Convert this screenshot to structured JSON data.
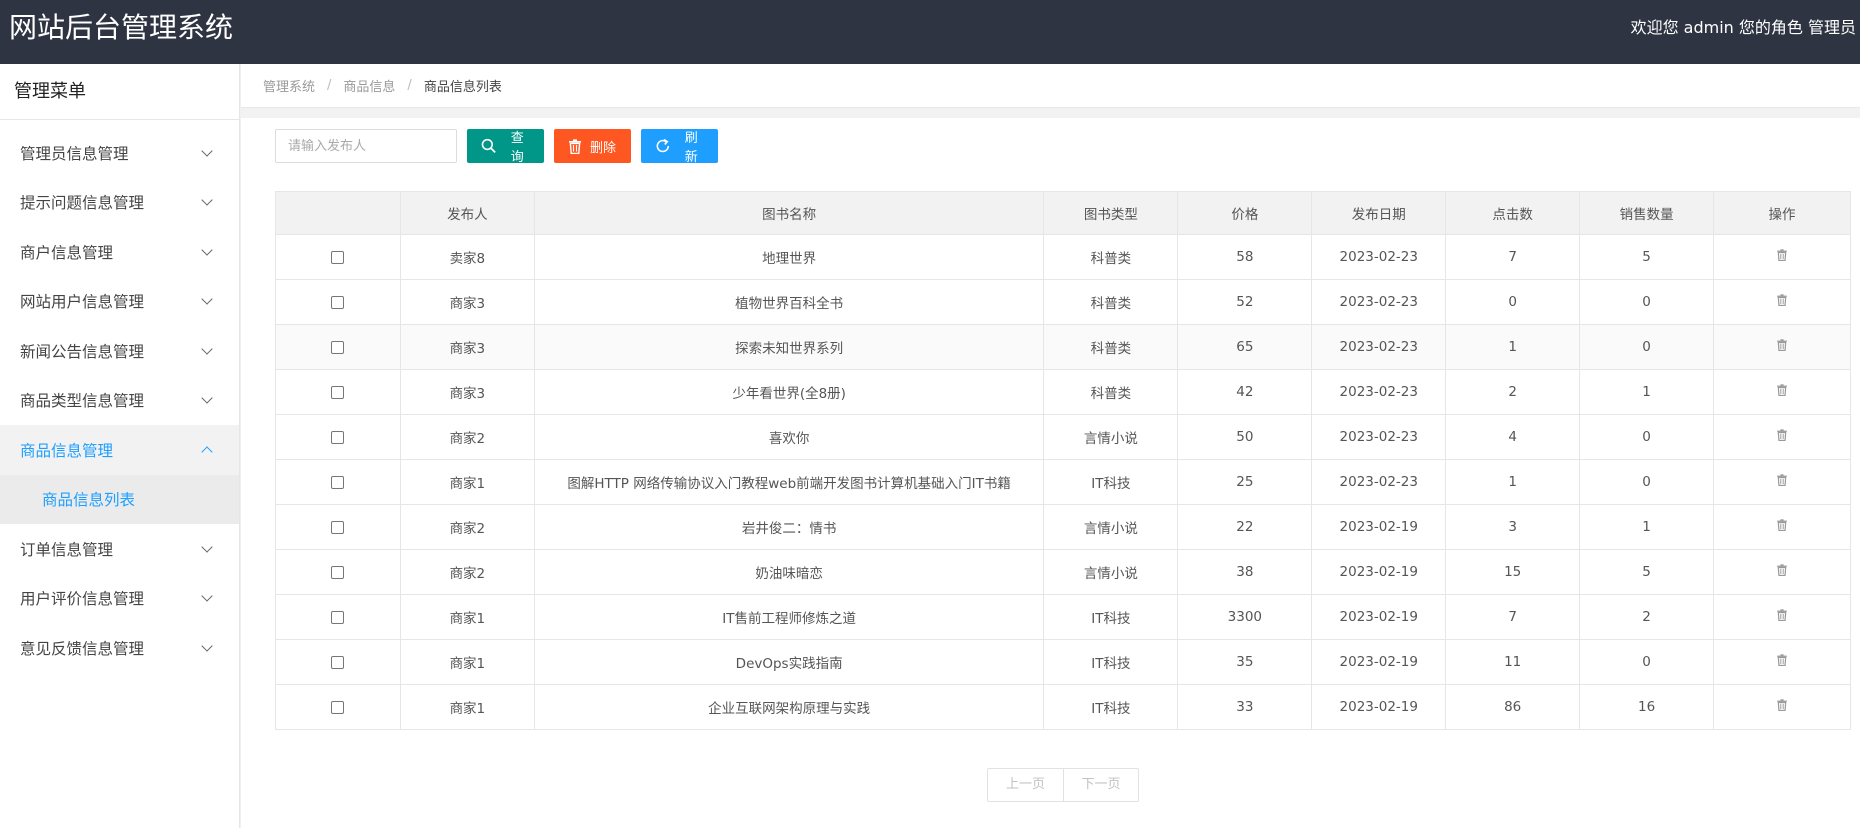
{
  "header": {
    "app_title": "网站后台管理系统",
    "welcome": "欢迎您 admin 您的角色 管理员"
  },
  "sidebar": {
    "title": "管理菜单",
    "items": [
      {
        "label": "管理员信息管理"
      },
      {
        "label": "提示问题信息管理"
      },
      {
        "label": "商户信息管理"
      },
      {
        "label": "网站用户信息管理"
      },
      {
        "label": "新闻公告信息管理"
      },
      {
        "label": "商品类型信息管理"
      },
      {
        "label": "商品信息管理"
      },
      {
        "label": "订单信息管理"
      },
      {
        "label": "用户评价信息管理"
      },
      {
        "label": "意见反馈信息管理"
      }
    ],
    "active_sub_item": "商品信息列表"
  },
  "breadcrumb": [
    "管理系统",
    "商品信息",
    "商品信息列表"
  ],
  "toolbar": {
    "search_placeholder": "请输入发布人",
    "query_label": "查询",
    "delete_label": "删除",
    "refresh_label": "刷新"
  },
  "table": {
    "columns": [
      "发布人",
      "图书名称",
      "图书类型",
      "价格",
      "发布日期",
      "点击数",
      "销售数量",
      "操作"
    ],
    "rows": [
      [
        "卖家8",
        "地理世界",
        "科普类",
        "58",
        "2023-02-23",
        "7",
        "5"
      ],
      [
        "商家3",
        "植物世界百科全书",
        "科普类",
        "52",
        "2023-02-23",
        "0",
        "0"
      ],
      [
        "商家3",
        "探索未知世界系列",
        "科普类",
        "65",
        "2023-02-23",
        "1",
        "0"
      ],
      [
        "商家3",
        "少年看世界(全8册)",
        "科普类",
        "42",
        "2023-02-23",
        "2",
        "1"
      ],
      [
        "商家2",
        "喜欢你",
        "言情小说",
        "50",
        "2023-02-23",
        "4",
        "0"
      ],
      [
        "商家1",
        "图解HTTP 网络传输协议入门教程web前端开发图书计算机基础入门IT书籍",
        "IT科技",
        "25",
        "2023-02-23",
        "1",
        "0"
      ],
      [
        "商家2",
        "岩井俊二：情书",
        "言情小说",
        "22",
        "2023-02-19",
        "3",
        "1"
      ],
      [
        "商家2",
        "奶油味暗恋",
        "言情小说",
        "38",
        "2023-02-19",
        "15",
        "5"
      ],
      [
        "商家1",
        "IT售前工程师修炼之道",
        "IT科技",
        "3300",
        "2023-02-19",
        "7",
        "2"
      ],
      [
        "商家1",
        "DevOps实践指南",
        "IT科技",
        "35",
        "2023-02-19",
        "11",
        "0"
      ],
      [
        "商家1",
        "企业互联网架构原理与实践",
        "IT科技",
        "33",
        "2023-02-19",
        "86",
        "16"
      ]
    ]
  },
  "pager": {
    "prev_label": "上一页",
    "next_label": "下一页"
  },
  "colors": {
    "header_bg": "#2f3442",
    "accent": "#1e9fff",
    "query_button": "#009688",
    "delete_button": "#ff5722",
    "refresh_button": "#1e9fff"
  }
}
